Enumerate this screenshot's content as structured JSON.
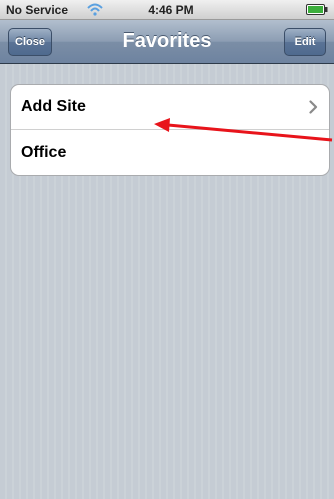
{
  "status_bar": {
    "carrier": "No Service",
    "time": "4:46 PM"
  },
  "nav": {
    "title": "Favorites",
    "close_label": "Close",
    "edit_label": "Edit"
  },
  "table": {
    "rows": [
      {
        "label": "Add Site",
        "accessory": "chevron-right-icon"
      },
      {
        "label": "Office"
      }
    ]
  },
  "colors": {
    "nav_bar": "#7b8ea6",
    "background": "#c5ccd4",
    "annotation_arrow": "#e8141b"
  },
  "icons": {
    "wifi": "wifi-icon",
    "battery": "battery-icon",
    "chevron": "chevron-right-icon",
    "annotation": "red-arrow-icon"
  }
}
